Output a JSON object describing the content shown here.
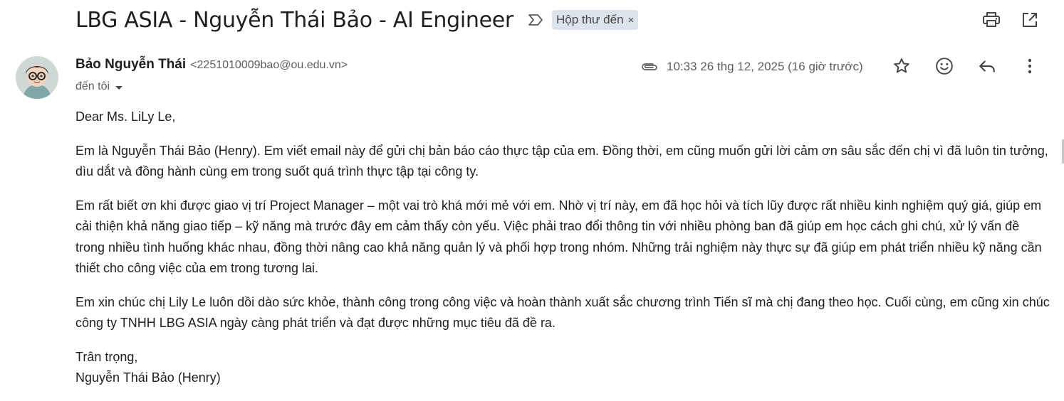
{
  "email": {
    "subject": "LBG ASIA - Nguyễn Thái Bảo - AI Engineer",
    "label": "Hộp thư đến",
    "label_close": "×",
    "sender_name": "Bảo Nguyễn Thái",
    "sender_email": "<2251010009bao@ou.edu.vn>",
    "to": "đến tôi",
    "date": "10:33 26 thg 12, 2025 (16 giờ trước)",
    "greeting": "Dear Ms. LiLy Le,",
    "paragraphs": [
      "Em là Nguyễn Thái Bảo (Henry). Em viết email này để gửi chị bản báo cáo thực tập của em. Đồng thời, em cũng muốn gửi lời cảm ơn sâu sắc đến chị vì đã luôn tin tưởng, dìu dắt và đồng hành cùng em trong suốt quá trình thực tập tại công ty.",
      "Em rất biết ơn khi được giao vị trí Project Manager – một vai trò khá mới mẻ với em. Nhờ vị trí này, em đã học hỏi và tích lũy được rất nhiều kinh nghiệm quý giá, giúp em cải thiện khả năng giao tiếp – kỹ năng mà trước đây em cảm thấy còn yếu. Việc phải trao đổi thông tin với nhiều phòng ban đã giúp em học cách ghi chú, xử lý vấn đề trong nhiều tình huống khác nhau, đồng thời nâng cao khả năng quản lý và phối hợp trong nhóm. Những trải nghiệm này thực sự đã giúp em phát triển nhiều kỹ năng cần thiết cho công việc của em trong tương lai.",
      "Em xin chúc chị Lily Le luôn dồi dào sức khỏe, thành công trong công việc và hoàn thành xuất sắc chương trình Tiến sĩ mà chị đang theo học. Cuối cùng, em cũng xin chúc công ty TNHH LBG ASIA ngày càng phát triển và đạt được những mục tiêu đã đề ra."
    ],
    "closing": "Trân trọng,",
    "signature": "Nguyễn Thái Bảo (Henry)"
  },
  "icons": {
    "important": "important-marker-icon",
    "print": "print-icon",
    "open_new_window": "open-in-new-window-icon",
    "attachment": "attachment-icon",
    "star": "star-icon",
    "emoji": "emoji-reaction-icon",
    "reply": "reply-icon",
    "more": "more-vertical-icon"
  },
  "colors": {
    "label_chip_bg": "#dde3ea",
    "text_primary": "#1f1f1f",
    "text_secondary": "#5e5e5e",
    "icon": "#444746"
  }
}
